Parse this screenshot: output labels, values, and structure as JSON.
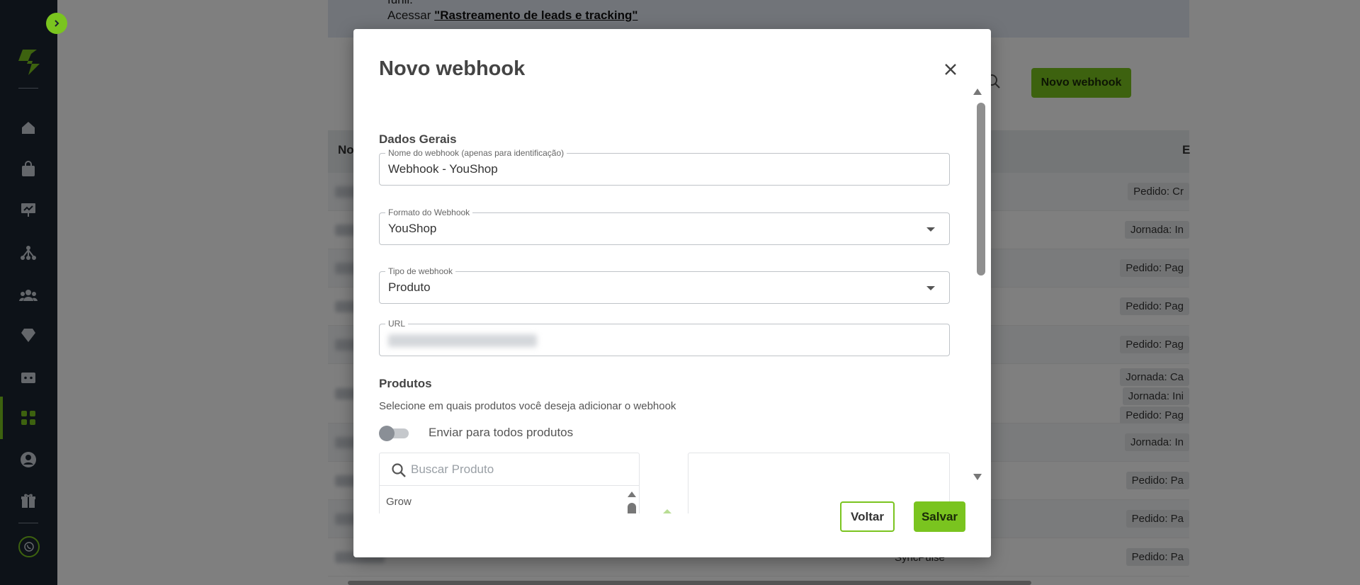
{
  "banner": {
    "top_line": "funil.",
    "access_prefix": "Acessar ",
    "access_link": "\"Rastreamento de leads e tracking\""
  },
  "toolbar": {
    "new_webhook_label": "Novo webhook"
  },
  "table": {
    "header_name": "Nome",
    "header_events": "E",
    "rows": [
      {
        "chips": [
          "Pedido: Cr"
        ]
      },
      {
        "chips": [
          "Jornada: In"
        ]
      },
      {
        "chips": [
          "Pedido: Pag"
        ]
      },
      {
        "chips": [
          "Pedido: Pag"
        ]
      },
      {
        "chips": [
          "Pedido: Pag"
        ]
      },
      {
        "chips": [
          "Jornada: Ca",
          "Jornada: Ini",
          "Pedido: Pag"
        ]
      },
      {
        "chips": [
          "Jornada: In"
        ]
      },
      {
        "chips": [
          "Pedido: Pa"
        ]
      },
      {
        "chips": [
          "Pedido: Pa"
        ]
      },
      {
        "chips": [
          "Pedido: Pa"
        ]
      }
    ],
    "last_row_source": "SyncPulse"
  },
  "modal": {
    "title": "Novo webhook",
    "section_general": "Dados Gerais",
    "name_field": {
      "label": "Nome do webhook (apenas para identificação)",
      "value": "Webhook - YouShop"
    },
    "format_field": {
      "label": "Formato do Webhook",
      "value": "YouShop"
    },
    "type_field": {
      "label": "Tipo de webhook",
      "value": "Produto"
    },
    "url_field": {
      "label": "URL"
    },
    "section_products": "Produtos",
    "products_desc": "Selecione em quais produtos você deseja adicionar o webhook",
    "toggle_label": "Enviar para todos produtos",
    "toggle_on": false,
    "search_placeholder": "Buscar Produto",
    "product_items": [
      "Grow"
    ],
    "back_label": "Voltar",
    "save_label": "Salvar"
  },
  "colors": {
    "accent": "#7ac41f",
    "sidebar": "#1b2431"
  }
}
